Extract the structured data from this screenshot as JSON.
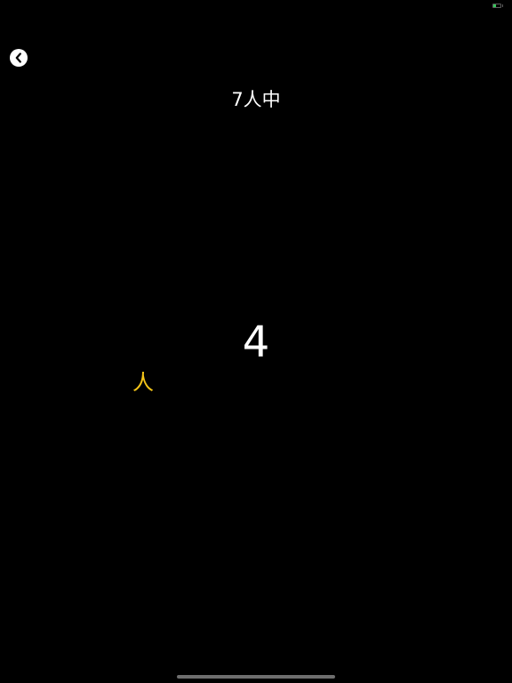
{
  "status_bar": {
    "battery_level": 0.4,
    "battery_color": "#34c759"
  },
  "nav": {
    "back_icon": "chevron-left-icon"
  },
  "title": "7人中",
  "result": {
    "count": "4",
    "unit": "人",
    "unit_color": "#f5c518"
  }
}
